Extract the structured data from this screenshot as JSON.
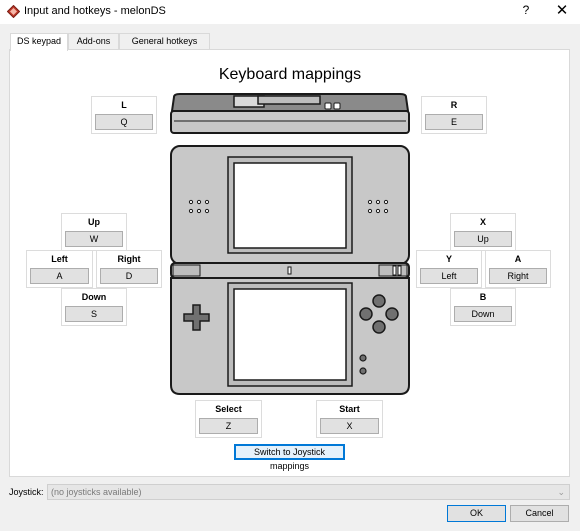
{
  "window": {
    "title": "Input and hotkeys - melonDS",
    "help_label": "?",
    "close_label": "✕"
  },
  "tabs": [
    {
      "label": "DS keypad",
      "active": true
    },
    {
      "label": "Add-ons",
      "active": false
    },
    {
      "label": "General hotkeys",
      "active": false
    }
  ],
  "heading": "Keyboard mappings",
  "mappings": {
    "l": {
      "label": "L",
      "key": "Q"
    },
    "r": {
      "label": "R",
      "key": "E"
    },
    "up": {
      "label": "Up",
      "key": "W"
    },
    "left": {
      "label": "Left",
      "key": "A"
    },
    "right": {
      "label": "Right",
      "key": "D"
    },
    "down": {
      "label": "Down",
      "key": "S"
    },
    "x": {
      "label": "X",
      "key": "Up"
    },
    "y": {
      "label": "Y",
      "key": "Left"
    },
    "a": {
      "label": "A",
      "key": "Right"
    },
    "b": {
      "label": "B",
      "key": "Down"
    },
    "select": {
      "label": "Select",
      "key": "Z"
    },
    "start": {
      "label": "Start",
      "key": "X"
    }
  },
  "switch_button": "Switch to Joystick mappings",
  "joystick": {
    "label": "Joystick:",
    "value": "(no joysticks available)"
  },
  "buttons": {
    "ok": "OK",
    "cancel": "Cancel"
  },
  "colors": {
    "app_icon": "#c0392b",
    "ds_body": "#c8c8c8",
    "ds_outline": "#1a1a1a",
    "focus_accent": "#0078d7"
  }
}
